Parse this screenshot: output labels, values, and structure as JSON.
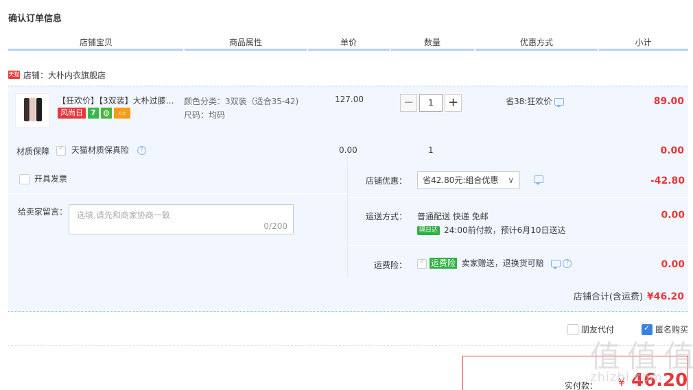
{
  "page": {
    "title": "确认订单信息"
  },
  "columns": [
    "店铺宝贝",
    "商品属性",
    "单价",
    "数量",
    "优惠方式",
    "小计"
  ],
  "shop": {
    "badge": "天猫",
    "label": "店铺：大朴内衣旗舰店"
  },
  "item": {
    "title": "【狂欢价】【3双装】大朴过膝…",
    "promo_tag": "风尚日",
    "promo_seven": "7",
    "attr_color": "颜色分类：3双装（适合35-42)",
    "attr_size": "尺码：均码",
    "unit_price": "127.00",
    "minus": "−",
    "quantity": "1",
    "plus": "+",
    "discount": "省38:狂欢价",
    "subtotal": "89.00"
  },
  "guarantee": {
    "label": "材质保障",
    "option": "天猫材质保真险",
    "price": "0.00",
    "quantity": "1",
    "subtotal": "0.00"
  },
  "invoice": {
    "label": "开具发票"
  },
  "memo": {
    "label": "给卖家留言：",
    "placeholder": "选填,请先和商家协商一致",
    "counter": "0/200"
  },
  "shop_discount": {
    "label": "店铺优惠：",
    "selected": "省42.80元:组合优惠",
    "amount": "-42.80"
  },
  "shipping": {
    "label": "运送方式：",
    "method": "普通配送 快递 免邮",
    "badge": "隔日达",
    "eta": "24:00前付款，预计6月10日送达",
    "amount": "0.00"
  },
  "insurance": {
    "label": "运费险：",
    "tag": "运费险",
    "desc": "卖家赠送，退换货可赔",
    "amount": "0.00"
  },
  "shop_total": {
    "label": "店铺合计(含运费)",
    "amount": "¥46.20"
  },
  "options": {
    "friend_pay": "朋友代付",
    "anonymous": "匿名购买"
  },
  "payment": {
    "label": "实付款：",
    "currency": "¥",
    "amount": "46.20"
  },
  "watermark": {
    "main": "值 值 值",
    "sub": "zhizhi.com"
  },
  "colors": {
    "accent_red": "#e4393c",
    "header_bar": "#b2d1ff",
    "box_bg": "#f2f7ff",
    "green": "#2cb040"
  }
}
